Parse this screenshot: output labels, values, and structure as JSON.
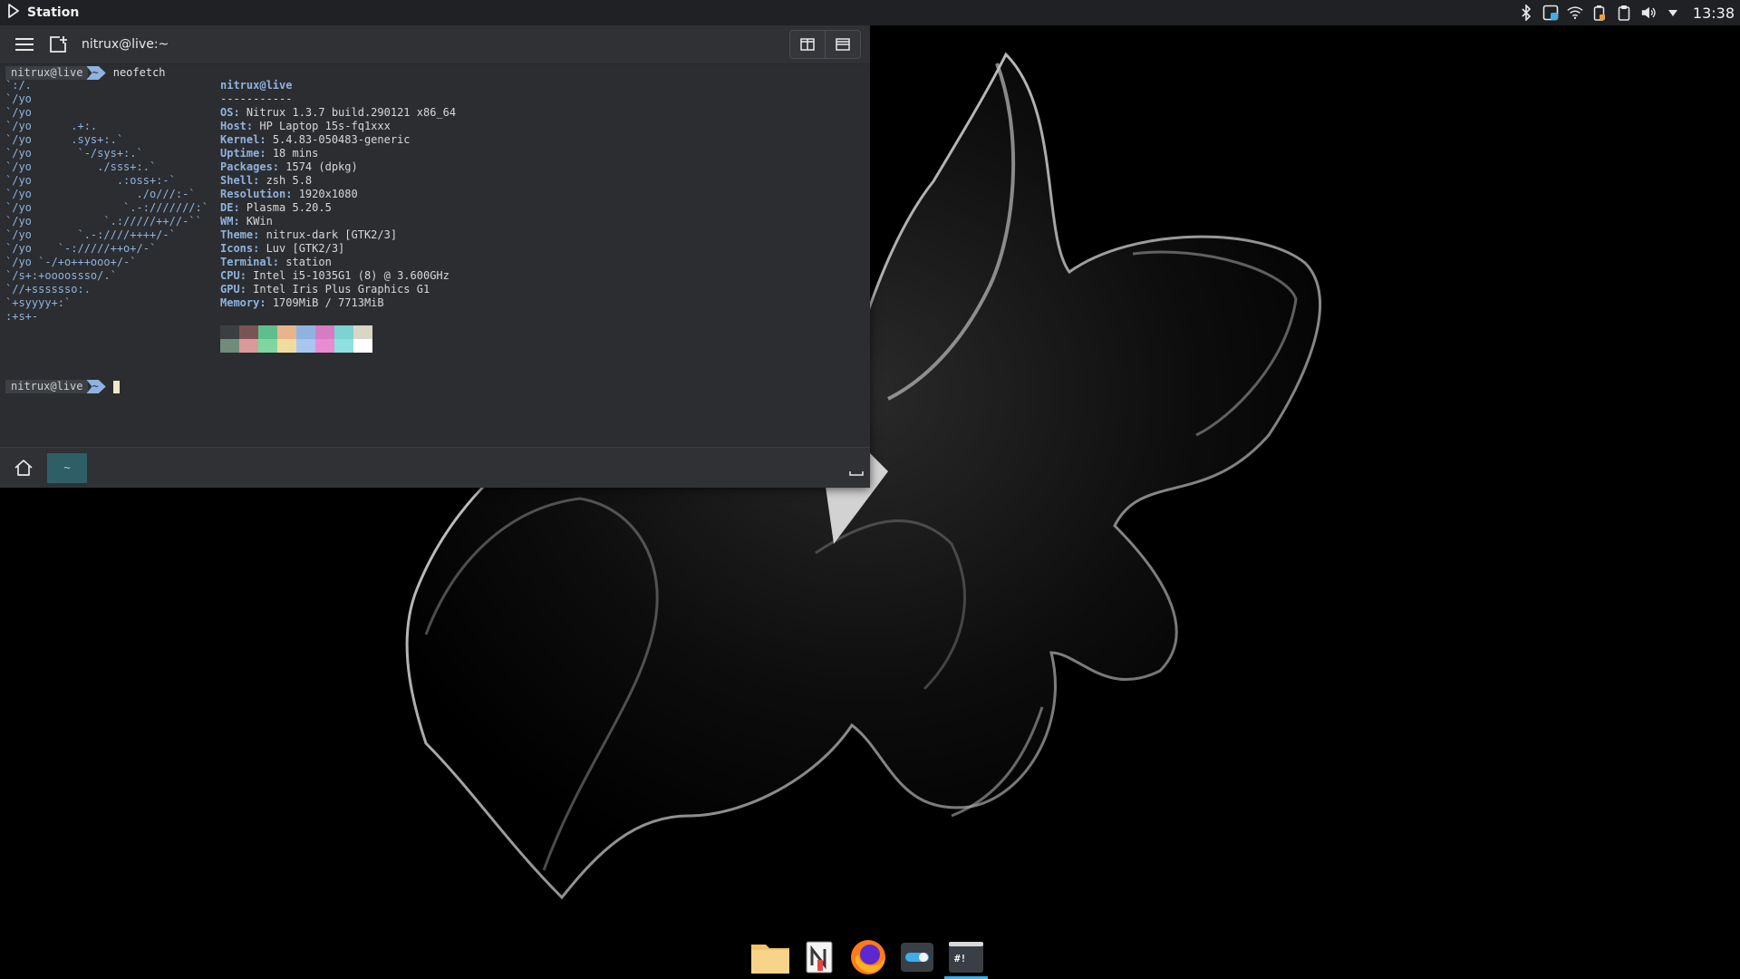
{
  "top_panel": {
    "app_title": "Station",
    "clock": "13:38",
    "tray_icons": [
      "bluetooth-icon",
      "keyboard-layout-icon",
      "wifi-icon",
      "battery-icon",
      "clipboard-icon",
      "volume-icon",
      "tray-expand-icon"
    ]
  },
  "window": {
    "title": "nitrux@live:~"
  },
  "terminal": {
    "prompt_user": "nitrux@live",
    "prompt_dir": "~",
    "command": "neofetch",
    "logo_lines": [
      "`:/.",
      "`/yo",
      "`/yo",
      "`/yo      .+:.",
      "`/yo      .sys+:.`",
      "`/yo       `-/sys+:.`",
      "`/yo          ./sss+:.`",
      "`/yo             .:oss+:-`",
      "`/yo                ./o///:-`",
      "`/yo              `.-:///////:`",
      "`/yo           `.://///++//-``",
      "`/yo       `.-:////++++/-`",
      "`/yo    `-://///++o+/-`",
      "`/yo `-/+o+++ooo+/-`",
      "`/s+:+oooossso/.`",
      "`//+sssssso:.",
      "`+syyyy+:`",
      ":+s+-"
    ],
    "info_header_user": "nitrux@live",
    "info_separator": "-----------",
    "info": [
      {
        "key": "OS",
        "value": "Nitrux 1.3.7 build.290121 x86_64"
      },
      {
        "key": "Host",
        "value": "HP Laptop 15s-fq1xxx"
      },
      {
        "key": "Kernel",
        "value": "5.4.83-050483-generic"
      },
      {
        "key": "Uptime",
        "value": "18 mins"
      },
      {
        "key": "Packages",
        "value": "1574 (dpkg)"
      },
      {
        "key": "Shell",
        "value": "zsh 5.8"
      },
      {
        "key": "Resolution",
        "value": "1920x1080"
      },
      {
        "key": "DE",
        "value": "Plasma 5.20.5"
      },
      {
        "key": "WM",
        "value": "KWin"
      },
      {
        "key": "Theme",
        "value": "nitrux-dark [GTK2/3]"
      },
      {
        "key": "Icons",
        "value": "Luv [GTK2/3]"
      },
      {
        "key": "Terminal",
        "value": "station"
      },
      {
        "key": "CPU",
        "value": "Intel i5-1035G1 (8) @ 3.600GHz"
      },
      {
        "key": "GPU",
        "value": "Intel Iris Plus Graphics G1"
      },
      {
        "key": "Memory",
        "value": "1709MiB / 7713MiB"
      }
    ],
    "color_swatches": [
      "#3c3f42",
      "#7a5454",
      "#5fbf8c",
      "#e8b48c",
      "#8fb3e0",
      "#d77cc3",
      "#7dd3d3",
      "#d9d6c8",
      "#6f8c7c",
      "#d99a9a",
      "#7fd6a0",
      "#f0dca0",
      "#a8c6f0",
      "#e88cd4",
      "#8fe0e0",
      "#ffffff"
    ]
  },
  "footer": {
    "tab_label": "~"
  },
  "dock": {
    "items": [
      {
        "name": "files-icon",
        "color": "#f2c46a"
      },
      {
        "name": "notes-icon",
        "color": "#f0f0f0"
      },
      {
        "name": "firefox-icon",
        "color": "#ff7a1a"
      },
      {
        "name": "settings-toggle-icon",
        "color": "#3daee9"
      },
      {
        "name": "station-terminal-icon",
        "color": "#3a3f46"
      }
    ]
  },
  "colors": {
    "accent": "#3daee9",
    "prompt_dir_bg": "#8fb3e0",
    "terminal_bg": "#2b2d30",
    "panel_bg": "#1f2125"
  }
}
